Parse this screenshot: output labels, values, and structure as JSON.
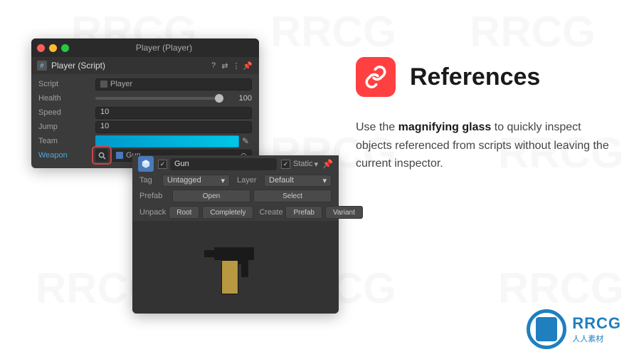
{
  "window1": {
    "title": "Player (Player)",
    "component": "Player (Script)",
    "fields": {
      "script_label": "Script",
      "script_value": "Player",
      "health_label": "Health",
      "health_value": "100",
      "speed_label": "Speed",
      "speed_value": "10",
      "jump_label": "Jump",
      "jump_value": "10",
      "team_label": "Team",
      "weapon_label": "Weapon",
      "weapon_value": "Gun"
    }
  },
  "window2": {
    "name": "Gun",
    "static_label": "Static",
    "tag_label": "Tag",
    "tag_value": "Untagged",
    "layer_label": "Layer",
    "layer_value": "Default",
    "prefab_label": "Prefab",
    "open_btn": "Open",
    "select_btn": "Select",
    "unpack_label": "Unpack",
    "root_btn": "Root",
    "completely_btn": "Completely",
    "create_label": "Create",
    "prefab_btn": "Prefab",
    "variant_btn": "Variant"
  },
  "right": {
    "title": "References",
    "text_pre": "Use the ",
    "text_bold": "magnifying glass",
    "text_post": " to quickly inspect objects referenced from scripts without leaving the current inspector."
  },
  "brand": {
    "name": "RRCG",
    "sub": "人人素材"
  },
  "watermark": "RRCG"
}
